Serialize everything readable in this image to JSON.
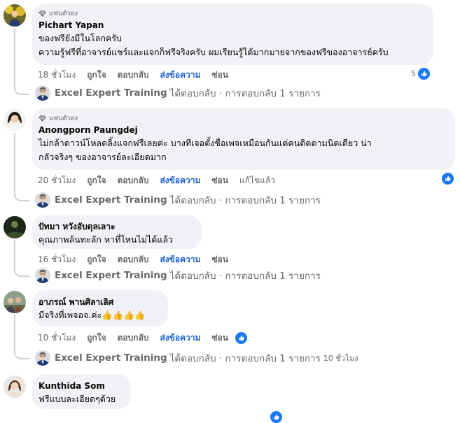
{
  "common": {
    "fan_badge": "แฟนตัวยง",
    "like": "ถูกใจ",
    "reply": "ตอบกลับ",
    "send_message": "ส่งข้อความ",
    "hide": "ซ่อน",
    "edited": "แก้ไขแล้ว",
    "replier_name": "Excel Expert Training",
    "replied_text": "ได้ตอบกลับ · การตอบกลับ 1 รายการ"
  },
  "comments": [
    {
      "author": "Pichart Yapan",
      "text": "ของฟรียังมีในโลกครับ\nความรู้ฟรีที่อาจารย์แชร์และแจกก็ฟรีจริงครับ ผมเรียนรู้ได้มากมายจากของฟรีของอาจารย์ครับ",
      "time": "18 ชั่วโมง",
      "reactions": "5"
    },
    {
      "author": "Anongporn Paungdej",
      "text": "ไม่กล้าดาวน์โหลดลิ้งแจกฟรีเลยค่ะ บางทีเจอตั้งชื่อเพจเหมือนกันแต่คนติดตามนิดเดียว น่า\nกลัวจริงๆ ของอาจารย์ละเอียดมาก",
      "time": "20 ชั่วโมง"
    },
    {
      "author": "ปัทมา หวังอับดุลเลาะ",
      "text": "คุณภาพล้นทะลัก หาที่ไหนไม่ได้แล้ว",
      "time": "16 ชั่วโมง"
    },
    {
      "author": "อาภรณ์ พานศิลาเลิศ",
      "text": "มีจริงที่เพจอจ.ค่ะ👍👍👍👍",
      "time": "10 ชั่วโมง",
      "reply_time": "10 ชั่วโมง"
    },
    {
      "author": "Kunthida Som",
      "text": "ฟรีแบบละเอียดๆด้วย"
    }
  ],
  "colors": {
    "bubble": "#f0f2f5",
    "link_blue": "#1a5fd1",
    "like_blue": "#1877f2",
    "muted": "#65676b"
  }
}
